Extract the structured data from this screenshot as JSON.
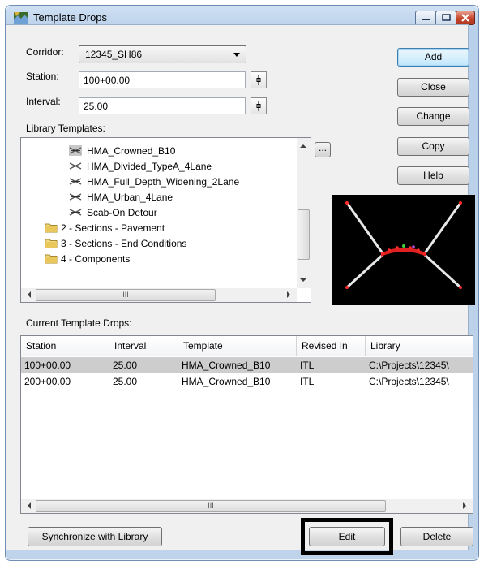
{
  "window": {
    "title": "Template Drops"
  },
  "form": {
    "corridor_label": "Corridor:",
    "corridor_value": "12345_SH86",
    "station_label": "Station:",
    "station_value": "100+00.00",
    "interval_label": "Interval:",
    "interval_value": "25.00",
    "library_label": "Library Templates:",
    "current_label": "Current Template Drops:"
  },
  "buttons": {
    "add": "Add",
    "close": "Close",
    "change": "Change",
    "copy": "Copy",
    "help": "Help",
    "browse": "...",
    "synchronize": "Synchronize with Library",
    "edit": "Edit",
    "delete": "Delete"
  },
  "tree": {
    "items": [
      {
        "label": "HMA_Crowned_B10",
        "type": "template",
        "selected": true
      },
      {
        "label": "HMA_Divided_TypeA_4Lane",
        "type": "template"
      },
      {
        "label": "HMA_Full_Depth_Widening_2Lane",
        "type": "template"
      },
      {
        "label": "HMA_Urban_4Lane",
        "type": "template"
      },
      {
        "label": "Scab-On Detour",
        "type": "template"
      },
      {
        "label": "2 - Sections - Pavement",
        "type": "folder"
      },
      {
        "label": "3 - Sections - End Conditions",
        "type": "folder"
      },
      {
        "label": "4 - Components",
        "type": "folder"
      }
    ]
  },
  "table": {
    "columns": [
      "Station",
      "Interval",
      "Template",
      "Revised In",
      "Library"
    ],
    "rows": [
      [
        "100+00.00",
        "25.00",
        "HMA_Crowned_B10",
        "ITL",
        "C:\\Projects\\12345\\"
      ],
      [
        "200+00.00",
        "25.00",
        "HMA_Crowned_B10",
        "ITL",
        "C:\\Projects\\12345\\"
      ]
    ]
  },
  "scroll_glyph": "III",
  "colors": {
    "selection": "#cdcdcd",
    "preview_bg": "#000000",
    "template_points": "#ff2a2a",
    "titlebar": "#bfd3ea"
  }
}
